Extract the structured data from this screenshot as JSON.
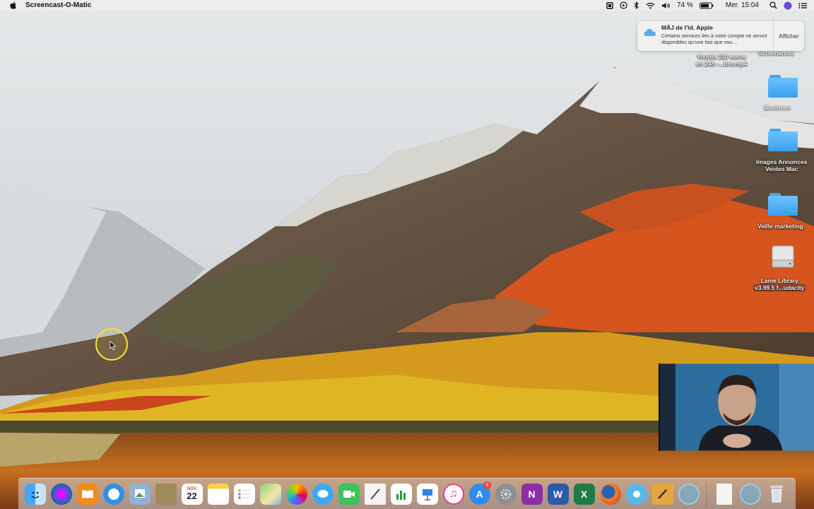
{
  "menubar": {
    "app_name": "Screencast-O-Matic",
    "battery": "74 %",
    "clock": "Mer. 15:04",
    "status_icons": [
      "cast-icon",
      "play-icon",
      "bluetooth-icon",
      "wifi-icon",
      "volume-icon",
      "battery-icon",
      "search-icon",
      "siri-icon",
      "notification-center-icon"
    ]
  },
  "notification": {
    "title": "MÀJ de l’id. Apple",
    "body": "Certains services liés à votre compte ne seront disponibles qu’une fois que vou…",
    "action": "Afficher"
  },
  "desktop": {
    "file1_line1": "Yoonla 100 euros",
    "file1_line2": "en 24h -...bre.mp4",
    "screenshots": "Screenshots",
    "business": "Business",
    "images_line1": "Images Annonces",
    "images_line2": "Ventes Mac",
    "veille": "Veille marketing",
    "lame_line1": "Lame Library",
    "lame_line2": "v3.99.5 f...udacity"
  },
  "dock": {
    "badge_appstore": "8",
    "calendar_month": "NOV",
    "calendar_day": "22",
    "apps": [
      "finder-icon",
      "siri-icon",
      "ibooks-icon",
      "safari-icon",
      "preview-icon",
      "notebook-icon",
      "calendar-icon",
      "notes-icon",
      "reminders-icon",
      "maps-icon",
      "photos-icon",
      "messages-icon",
      "facetime-icon",
      "textedit-icon",
      "numbers-icon",
      "keynote-icon",
      "itunes-icon",
      "app-store-icon",
      "system-preferences-icon",
      "onenote-icon",
      "word-icon",
      "excel-icon",
      "firefox-icon",
      "screencast-icon",
      "pencil-app-icon",
      "screencast-recorder-icon",
      "downloads-stack-icon",
      "screencast-stack-icon",
      "trash-icon"
    ]
  },
  "colors": {
    "menubar_bg": "#ececec",
    "folder_blue": "#4fb3f9",
    "cursor_ring": "#f2e23a"
  }
}
